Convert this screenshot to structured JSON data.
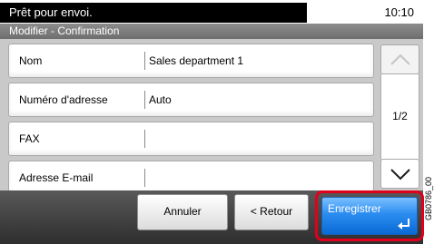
{
  "status": {
    "message": "Prêt pour envoi.",
    "time": "10:10"
  },
  "title": "Modifier - Confirmation",
  "fields": [
    {
      "label": "Nom",
      "value": "Sales department 1"
    },
    {
      "label": "Numéro d'adresse",
      "value": "Auto"
    },
    {
      "label": "FAX",
      "value": ""
    },
    {
      "label": "Adresse E-mail",
      "value": ""
    }
  ],
  "pagination": {
    "page": "1/2",
    "up_icon": "chevron-up-icon",
    "down_icon": "chevron-down-icon"
  },
  "buttons": {
    "cancel": "Annuler",
    "back": "< Retour",
    "save": "Enregistrer",
    "enter_icon": "enter-icon"
  },
  "side_code": "GB0786_00",
  "colors": {
    "highlight": "#e0001b",
    "primary": "#2b8cf0",
    "status_bg": "#000000"
  }
}
